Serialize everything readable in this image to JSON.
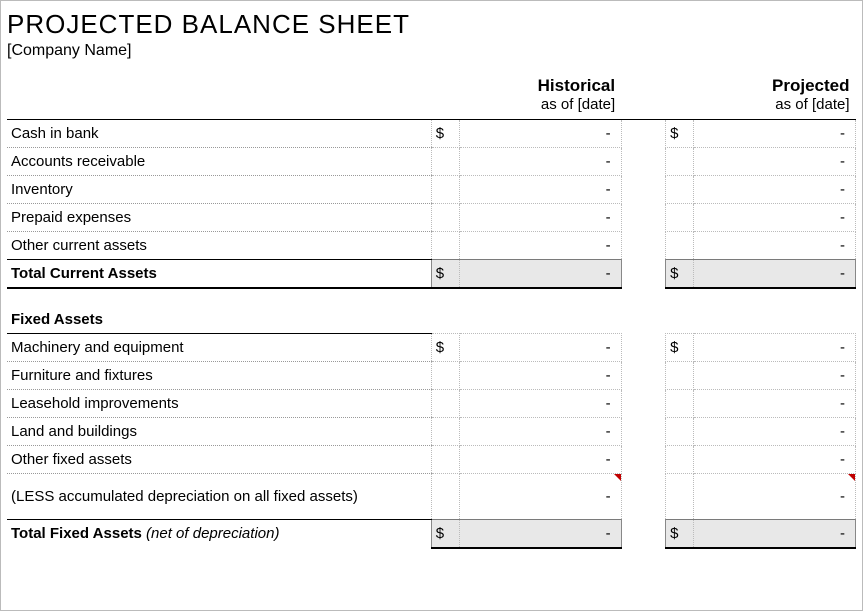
{
  "title": "PROJECTED BALANCE SHEET",
  "company": "[Company Name]",
  "columns": {
    "hist": {
      "title": "Historical",
      "sub": "as of [date]"
    },
    "proj": {
      "title": "Projected",
      "sub": "as of [date]"
    }
  },
  "currency": "$",
  "dash": "-",
  "current_assets": {
    "rows": [
      {
        "label": "Cash in bank",
        "show_cur": true
      },
      {
        "label": "Accounts receivable",
        "show_cur": false
      },
      {
        "label": "Inventory",
        "show_cur": false
      },
      {
        "label": "Prepaid expenses",
        "show_cur": false
      },
      {
        "label": "Other current assets",
        "show_cur": false
      }
    ],
    "total_label": "Total Current Assets"
  },
  "fixed_assets": {
    "section_label": "Fixed Assets",
    "rows": [
      {
        "label": "Machinery and equipment",
        "show_cur": true
      },
      {
        "label": "Furniture and fixtures",
        "show_cur": false
      },
      {
        "label": "Leasehold improvements",
        "show_cur": false
      },
      {
        "label": "Land and buildings",
        "show_cur": false
      },
      {
        "label": "Other fixed assets",
        "show_cur": false
      },
      {
        "label": "(LESS accumulated depreciation on all fixed assets)",
        "show_cur": false,
        "tall": true,
        "marker": true
      }
    ],
    "total_label_a": "Total Fixed Assets ",
    "total_label_b": "(net of depreciation)"
  }
}
